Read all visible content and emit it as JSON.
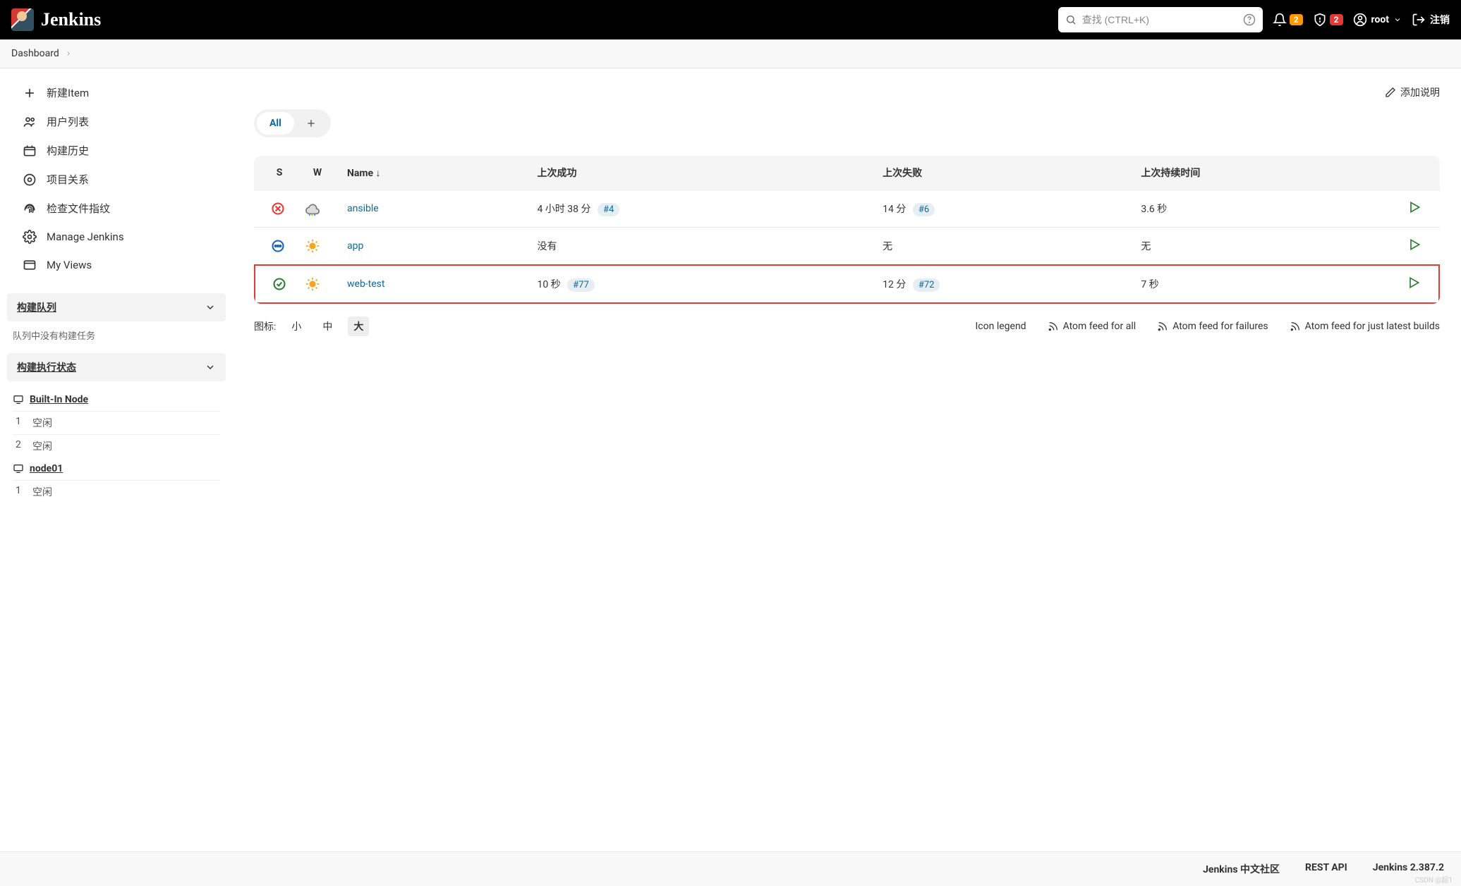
{
  "header": {
    "logo_text": "Jenkins",
    "search_placeholder": "查找 (CTRL+K)",
    "notif_badge": "2",
    "security_badge": "2",
    "username": "root",
    "logout": "注销"
  },
  "breadcrumb": {
    "dashboard": "Dashboard"
  },
  "sidebar": {
    "nav": [
      {
        "key": "new-item",
        "label": "新建Item"
      },
      {
        "key": "people",
        "label": "用户列表"
      },
      {
        "key": "build-history",
        "label": "构建历史"
      },
      {
        "key": "project-rel",
        "label": "项目关系"
      },
      {
        "key": "fingerprint",
        "label": "检查文件指纹"
      },
      {
        "key": "manage",
        "label": "Manage Jenkins"
      },
      {
        "key": "my-views",
        "label": "My Views"
      }
    ],
    "queue": {
      "title": "构建队列",
      "empty": "队列中没有构建任务"
    },
    "executors": {
      "title": "构建执行状态",
      "nodes": [
        {
          "name": "Built-In Node",
          "slots": [
            {
              "n": "1",
              "state": "空闲"
            },
            {
              "n": "2",
              "state": "空闲"
            }
          ]
        },
        {
          "name": "node01",
          "slots": [
            {
              "n": "1",
              "state": "空闲"
            }
          ]
        }
      ]
    }
  },
  "main": {
    "add_description": "添加说明",
    "tabs": {
      "all": "All"
    },
    "table": {
      "headers": {
        "s": "S",
        "w": "W",
        "name": "Name ↓",
        "last_success": "上次成功",
        "last_failure": "上次失败",
        "last_duration": "上次持续时间"
      },
      "rows": [
        {
          "status": "fail",
          "weather": "cloud",
          "name": "ansible",
          "last_success": "4 小时 38 分",
          "last_success_build": "#4",
          "last_failure": "14 分",
          "last_failure_build": "#6",
          "duration": "3.6 秒",
          "highlighted": false
        },
        {
          "status": "run",
          "weather": "sun",
          "name": "app",
          "last_success": "没有",
          "last_success_build": "",
          "last_failure": "无",
          "last_failure_build": "",
          "duration": "无",
          "highlighted": false
        },
        {
          "status": "ok",
          "weather": "sun",
          "name": "web-test",
          "last_success": "10 秒",
          "last_success_build": "#77",
          "last_failure": "12 分",
          "last_failure_build": "#72",
          "duration": "7 秒",
          "highlighted": true
        }
      ]
    },
    "table_footer": {
      "icon_label": "图标:",
      "sizes": {
        "small": "小",
        "medium": "中",
        "large": "大"
      },
      "icon_legend": "Icon legend",
      "atom_all": "Atom feed for all",
      "atom_fail": "Atom feed for failures",
      "atom_latest": "Atom feed for just latest builds"
    }
  },
  "footer": {
    "community": "Jenkins 中文社区",
    "rest": "REST API",
    "version": "Jenkins 2.387.2"
  },
  "watermark": "CSDN @超1"
}
